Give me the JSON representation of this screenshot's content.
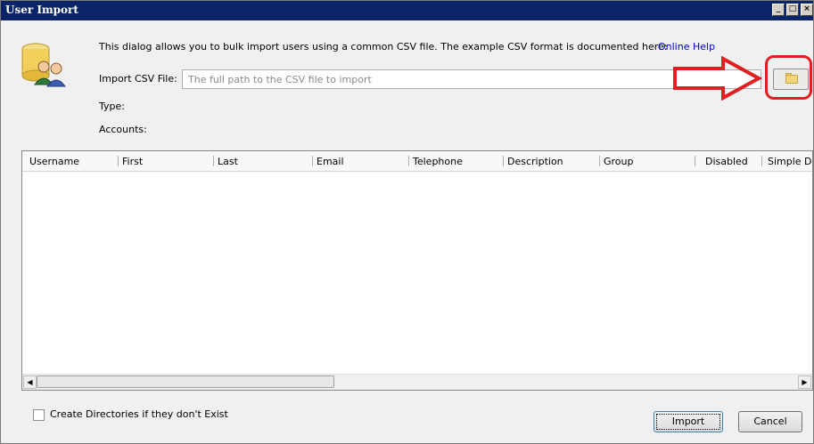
{
  "window": {
    "title": "User Import",
    "controls": [
      "_",
      "□",
      "×"
    ]
  },
  "header": {
    "description": "This dialog allows you to bulk import users using a common CSV file.  The example CSV format is documented here:",
    "help_link": "Online Help"
  },
  "form": {
    "csv_label": "Import CSV File:",
    "csv_value": "",
    "csv_placeholder": "The full path to the CSV file to import",
    "type_label": "Type:",
    "accounts_label": "Accounts:"
  },
  "grid": {
    "columns": [
      "Username",
      "First",
      "Last",
      "Email",
      "Telephone",
      "Description",
      "Group",
      "Disabled",
      "Simple Di"
    ],
    "rows": []
  },
  "scrollbar": {
    "left_arrow": "◀",
    "right_arrow": "▶"
  },
  "options": {
    "create_dirs_label": "Create Directories if they don't Exist",
    "create_dirs_checked": false
  },
  "buttons": {
    "import_label": "Import",
    "cancel_label": "Cancel"
  },
  "colors": {
    "titlebar": "#0a246a",
    "highlight": "#e02020",
    "link": "#0000cc"
  }
}
